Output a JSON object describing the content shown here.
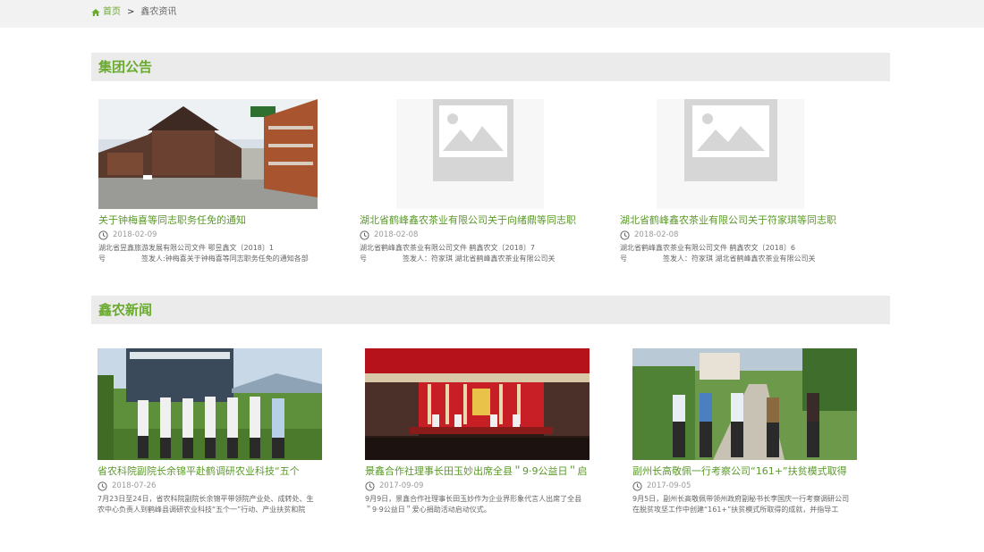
{
  "breadcrumb": {
    "home": "首页",
    "separator": ">",
    "current": "鑫农资讯"
  },
  "sections": [
    {
      "title": "集团公告"
    },
    {
      "title": "鑫农新闻"
    }
  ],
  "announcements": [
    {
      "title": "关于钟梅喜等同志职务任免的通知",
      "date": "2018-02-09",
      "summary_l1": "湖北省昱鑫旅游发展有限公司文件 鄂昱鑫文〔2018〕1",
      "summary_l2": "号　　　　　签发人:钟梅喜关于钟梅喜等同志职务任免的通知各部门:"
    },
    {
      "title": "湖北省鹤峰鑫农茶业有限公司关于向绪鼎等同志职",
      "date": "2018-02-08",
      "summary_l1": "湖北省鹤峰鑫农茶业有限公司文件 鹤鑫农文〔2018〕7",
      "summary_l2": "号　　　　　签发人：符家琪 湖北省鹤峰鑫农茶业有限公司关"
    },
    {
      "title": "湖北省鹤峰鑫农茶业有限公司关于符家琪等同志职",
      "date": "2018-02-08",
      "summary_l1": "湖北省鹤峰鑫农茶业有限公司文件 鹤鑫农文〔2018〕6",
      "summary_l2": "号　　　　　签发人：符家琪 湖北省鹤峰鑫农茶业有限公司关"
    }
  ],
  "news": [
    {
      "title": "省农科院副院长余锦平赴鹤调研农业科技“五个",
      "date": "2018-07-26",
      "summary_l1": "7月23日至24日，省农科院副院长余锦平带领院产业处、成转处、生",
      "summary_l2": "农中心负责人到鹤峰县调研农业科技“五个一”行动、产业扶贫和院"
    },
    {
      "title": "景鑫合作社理事长田玉妙出席全县＂9·9公益日＂启",
      "date": "2017-09-09",
      "summary_l1": "9月9日，景鑫合作社理事长田玉妙作为企业界形象代言人出席了全县",
      "summary_l2": "＂9·9公益日＂爱心捐助活动启动仪式。"
    },
    {
      "title": "副州长高敬佩一行考察公司“161+”扶贫模式取得",
      "date": "2017-09-05",
      "summary_l1": "9月5日，副州长高敬佩带领州政府副秘书长李国庆一行考察调研公司",
      "summary_l2": "在脱贫攻坚工作中创建“161+”扶贫模式所取得的成就，并指导工"
    }
  ],
  "colors": {
    "accent": "#6aaa2f",
    "header_bg": "#ebebeb",
    "bar_bg": "#f2f2f2"
  },
  "icons": {
    "home": "home-icon",
    "clock": "clock-icon",
    "placeholder": "image-placeholder-icon"
  }
}
